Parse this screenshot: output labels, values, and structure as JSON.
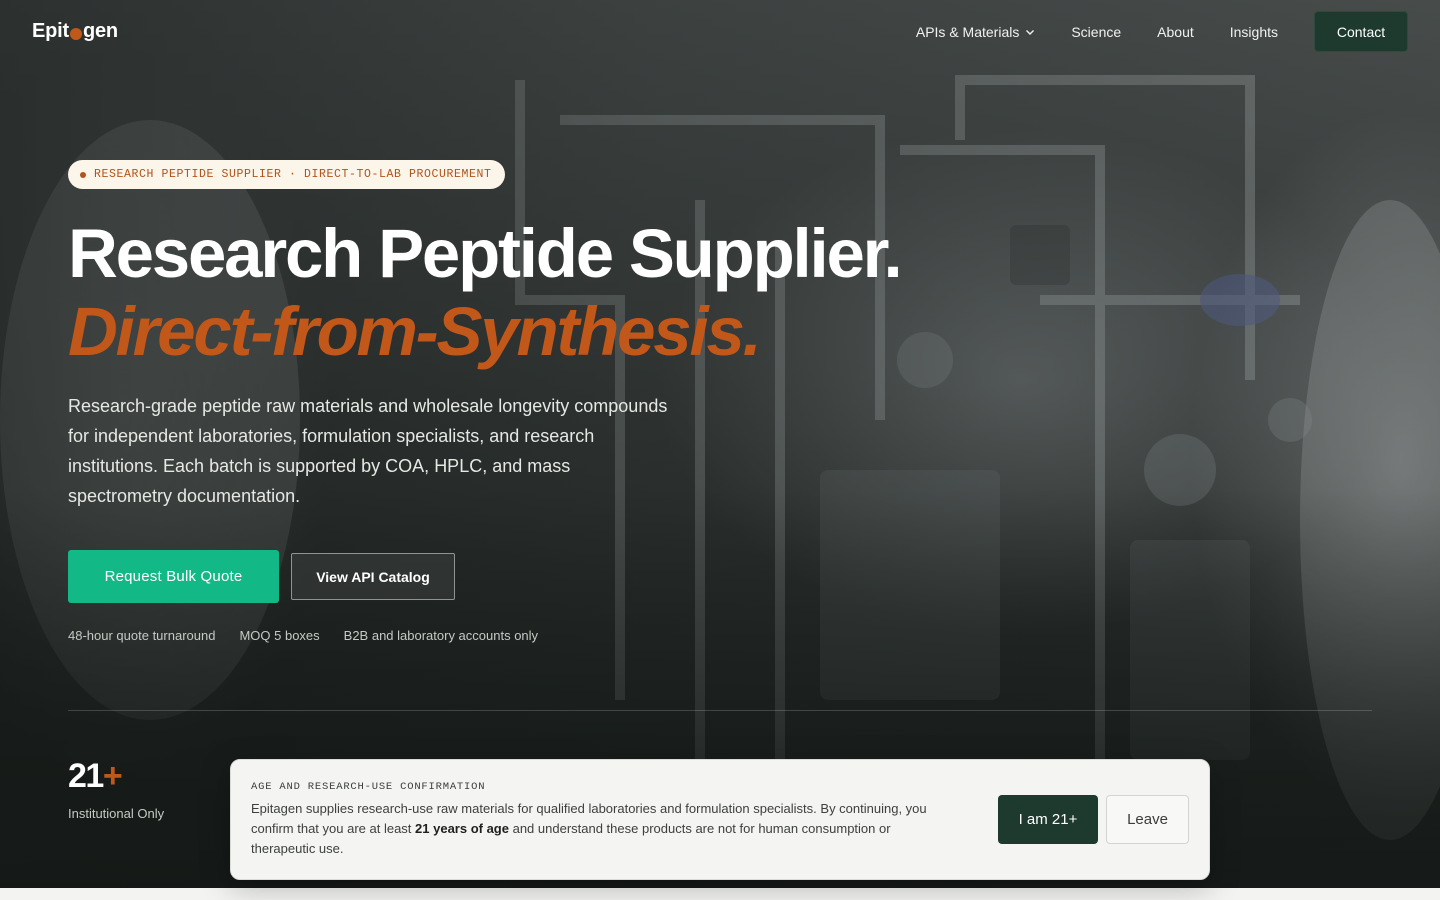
{
  "brand": {
    "name_start": "Epit",
    "name_end": "gen",
    "accent_color": "#c2571a"
  },
  "nav": {
    "items": [
      {
        "label": "APIs & Materials",
        "has_dropdown": true
      },
      {
        "label": "Science"
      },
      {
        "label": "About"
      },
      {
        "label": "Insights"
      }
    ],
    "contact_label": "Contact"
  },
  "hero": {
    "badge": "RESEARCH PEPTIDE SUPPLIER · DIRECT-TO-LAB PROCUREMENT",
    "headline": "Research Peptide Supplier.",
    "headline_accent": "Direct-from-Synthesis.",
    "lead": "Research-grade peptide raw materials and wholesale longevity compounds for independent laboratories, formulation specialists, and research institutions. Each batch is supported by COA, HPLC, and mass spectrometry documentation.",
    "primary_cta": "Request Bulk Quote",
    "secondary_cta": "View API Catalog",
    "meta": [
      "48-hour quote turnaround",
      "MOQ 5 boxes",
      "B2B and laboratory accounts only"
    ],
    "primary_color": "#12b886"
  },
  "stat": {
    "number": "21",
    "suffix": "+",
    "label": "Institutional Only"
  },
  "age_gate": {
    "title": "AGE AND RESEARCH-USE CONFIRMATION",
    "body_before": "Epitagen supplies research-use raw materials for qualified laboratories and formulation specialists. By continuing, you confirm that you are at least ",
    "body_bold": "21 years of age",
    "body_after": " and understand these products are not for human consumption or therapeutic use.",
    "confirm_label": "I am 21+",
    "leave_label": "Leave"
  }
}
